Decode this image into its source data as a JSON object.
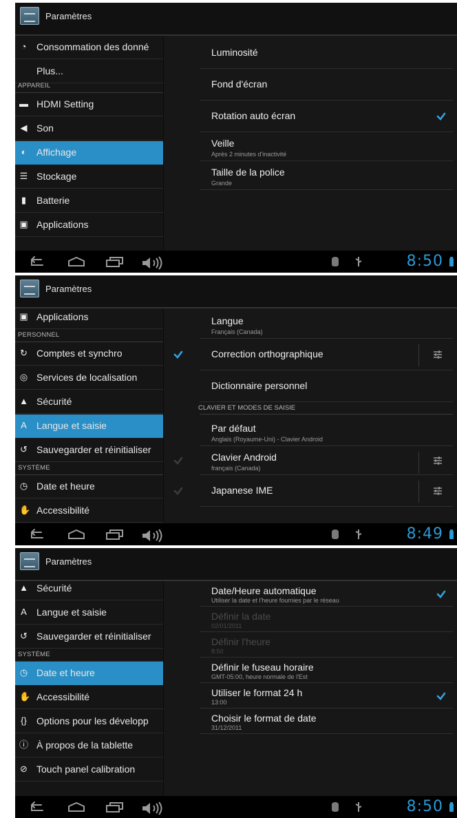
{
  "colors": {
    "accent": "#2a8fc6",
    "clock": "#2a9ad6",
    "background": "#0b0b0b"
  },
  "screens": [
    {
      "title": "Paramètres",
      "icon": "settings-app-icon",
      "left": [
        {
          "type": "item",
          "icon": "data-usage-icon",
          "label": "Consommation des donné"
        },
        {
          "type": "item",
          "icon": "",
          "label": "Plus..."
        },
        {
          "type": "header",
          "label": "APPAREIL"
        },
        {
          "type": "item",
          "icon": "hdmi-icon",
          "label": "HDMI Setting"
        },
        {
          "type": "item",
          "icon": "volume-icon",
          "label": "Son"
        },
        {
          "type": "item",
          "icon": "display-icon",
          "label": "Affichage",
          "active": true
        },
        {
          "type": "item",
          "icon": "storage-icon",
          "label": "Stockage"
        },
        {
          "type": "item",
          "icon": "battery-icon",
          "label": "Batterie"
        },
        {
          "type": "item",
          "icon": "apps-icon",
          "label": "Applications"
        }
      ],
      "right": [
        {
          "type": "pref",
          "title": "Luminosité",
          "summary": ""
        },
        {
          "type": "pref",
          "title": "Fond d'écran",
          "summary": ""
        },
        {
          "type": "pref",
          "title": "Rotation auto écran",
          "summary": "",
          "check": "right"
        },
        {
          "type": "pref",
          "title": "Veille",
          "summary": "Après 2 minutes d'inactivité"
        },
        {
          "type": "pref",
          "title": "Taille de la police",
          "summary": "Grande"
        }
      ],
      "clock": "8:50"
    },
    {
      "title": "Paramètres",
      "icon": "settings-app-icon",
      "left": [
        {
          "type": "item",
          "icon": "apps-icon",
          "label": "Applications"
        },
        {
          "type": "header",
          "label": "PERSONNEL"
        },
        {
          "type": "item",
          "icon": "sync-icon",
          "label": "Comptes et synchro"
        },
        {
          "type": "item",
          "icon": "location-icon",
          "label": "Services de localisation"
        },
        {
          "type": "item",
          "icon": "lock-icon",
          "label": "Sécurité"
        },
        {
          "type": "item",
          "icon": "keyboard-icon",
          "label": "Langue et saisie",
          "active": true
        },
        {
          "type": "item",
          "icon": "backup-icon",
          "label": "Sauvegarder et réinitialiser"
        },
        {
          "type": "header",
          "label": "SYSTÈME"
        },
        {
          "type": "item",
          "icon": "clock-icon",
          "label": "Date et heure"
        },
        {
          "type": "item",
          "icon": "accessibility-icon",
          "label": "Accessibilité"
        }
      ],
      "right": [
        {
          "type": "pref",
          "title": "Langue",
          "summary": "Français (Canada)"
        },
        {
          "type": "pref",
          "title": "Correction orthographique",
          "summary": "",
          "check": "left",
          "tune": true
        },
        {
          "type": "pref",
          "title": "Dictionnaire personnel",
          "summary": ""
        },
        {
          "type": "header",
          "label": "CLAVIER ET MODES DE SAISIE"
        },
        {
          "type": "pref",
          "title": "Par défaut",
          "summary": "Anglais (Royaume-Uni) - Clavier Android"
        },
        {
          "type": "pref",
          "title": "Clavier Android",
          "summary": "français (Canada)",
          "check": "left-dim",
          "tune": true
        },
        {
          "type": "pref",
          "title": "Japanese IME",
          "summary": "",
          "check": "left-dim",
          "tune": true
        }
      ],
      "clock": "8:49"
    },
    {
      "title": "Paramètres",
      "icon": "settings-app-icon",
      "left": [
        {
          "type": "item",
          "icon": "lock-icon",
          "label": "Sécurité"
        },
        {
          "type": "item",
          "icon": "keyboard-icon",
          "label": "Langue et saisie"
        },
        {
          "type": "item",
          "icon": "backup-icon",
          "label": "Sauvegarder et réinitialiser"
        },
        {
          "type": "header",
          "label": "SYSTÈME"
        },
        {
          "type": "item",
          "icon": "clock-icon",
          "label": "Date et heure",
          "active": true
        },
        {
          "type": "item",
          "icon": "accessibility-icon",
          "label": "Accessibilité"
        },
        {
          "type": "item",
          "icon": "developer-icon",
          "label": "Options pour les développ"
        },
        {
          "type": "item",
          "icon": "info-icon",
          "label": "À propos de la tablette"
        },
        {
          "type": "item",
          "icon": "calibration-icon",
          "label": "Touch panel calibration"
        }
      ],
      "right": [
        {
          "type": "pref",
          "title": "Date/Heure automatique",
          "summary": "Utiliser la date et l'heure fournies par le réseau",
          "check": "right"
        },
        {
          "type": "pref",
          "title": "Définir la date",
          "summary": "02/01/2011",
          "dim": true
        },
        {
          "type": "pref",
          "title": "Définir l'heure",
          "summary": "8:50",
          "dim": true
        },
        {
          "type": "pref",
          "title": "Définir le fuseau horaire",
          "summary": "GMT-05:00, heure normale de l'Est"
        },
        {
          "type": "pref",
          "title": "Utiliser le format 24 h",
          "summary": "13:00",
          "check": "right"
        },
        {
          "type": "pref",
          "title": "Choisir le format de date",
          "summary": "31/12/2011"
        }
      ],
      "clock": "8:50"
    }
  ]
}
